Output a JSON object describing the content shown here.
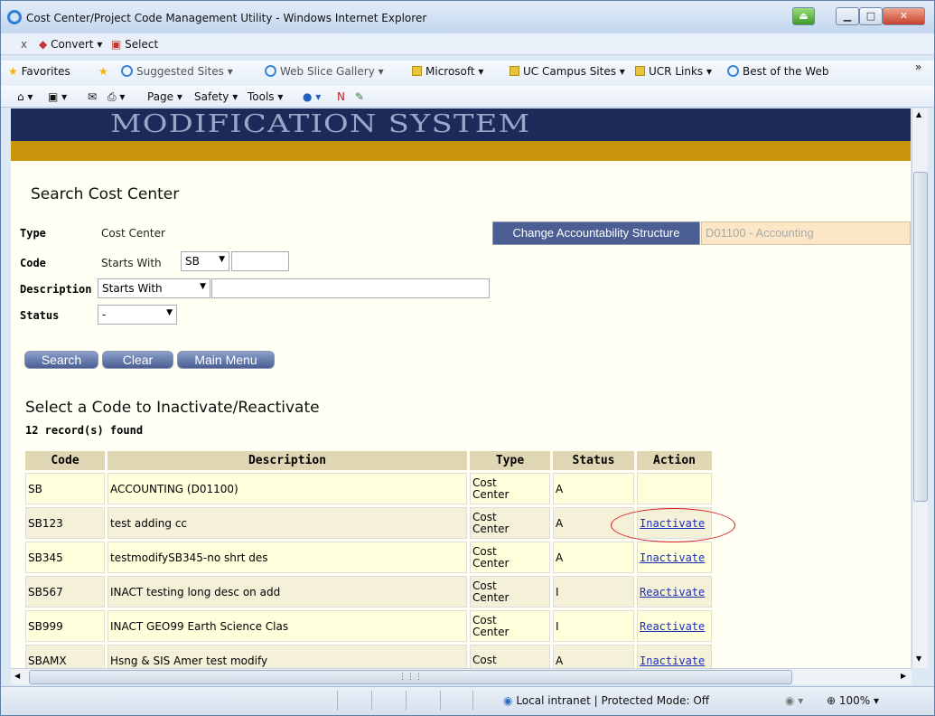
{
  "window": {
    "title": "Cost Center/Project Code Management Utility - Windows Internet Explorer"
  },
  "convert_bar": {
    "close": "x",
    "convert": "Convert ▾",
    "select": "Select"
  },
  "favorites_bar": {
    "favorites": "Favorites",
    "items": [
      "Suggested Sites ▾",
      "Web Slice Gallery ▾",
      "Microsoft ▾",
      "UC Campus Sites ▾",
      "UCR Links ▾",
      "Best of the Web"
    ],
    "overflow": "»"
  },
  "command_bar": {
    "page": "Page ▾",
    "safety": "Safety ▾",
    "tools": "Tools ▾"
  },
  "banner": {
    "text": "MODIFICATION SYSTEM"
  },
  "search": {
    "heading": "Search Cost Center",
    "type_label": "Type",
    "type_value": "Cost Center",
    "code_label": "Code",
    "code_prefix": "Starts With",
    "code_select": "SB",
    "code_input": "",
    "desc_label": "Description",
    "desc_select": "Starts With",
    "desc_input": "",
    "status_label": "Status",
    "status_select": "-",
    "change_button": "Change Accountability Structure",
    "accountability_value": "D01100 - Accounting",
    "search_button": "Search",
    "clear_button": "Clear",
    "main_menu_button": "Main Menu"
  },
  "results": {
    "heading": "Select a Code to Inactivate/Reactivate",
    "count": "12 record(s) found",
    "columns": [
      "Code",
      "Description",
      "Type",
      "Status",
      "Action"
    ],
    "rows": [
      {
        "code": "SB",
        "description": "ACCOUNTING (D01100)",
        "type": "Cost\nCenter",
        "status": "A",
        "action": ""
      },
      {
        "code": "SB123",
        "description": "test adding cc",
        "type": "Cost\nCenter",
        "status": "A",
        "action": "Inactivate"
      },
      {
        "code": "SB345",
        "description": "testmodifySB345-no shrt des",
        "type": "Cost\nCenter",
        "status": "A",
        "action": "Inactivate"
      },
      {
        "code": "SB567",
        "description": "INACT testing long desc on add",
        "type": "Cost\nCenter",
        "status": "I",
        "action": "Reactivate"
      },
      {
        "code": "SB999",
        "description": "INACT GEO99 Earth Science Clas",
        "type": "Cost\nCenter",
        "status": "I",
        "action": "Reactivate"
      },
      {
        "code": "SBAMX",
        "description": "Hsng & SIS Amer test modify",
        "type": "Cost",
        "status": "A",
        "action": "Inactivate"
      }
    ]
  },
  "statusbar": {
    "zone": "Local intranet | Protected Mode: Off",
    "zoom": "100%"
  }
}
